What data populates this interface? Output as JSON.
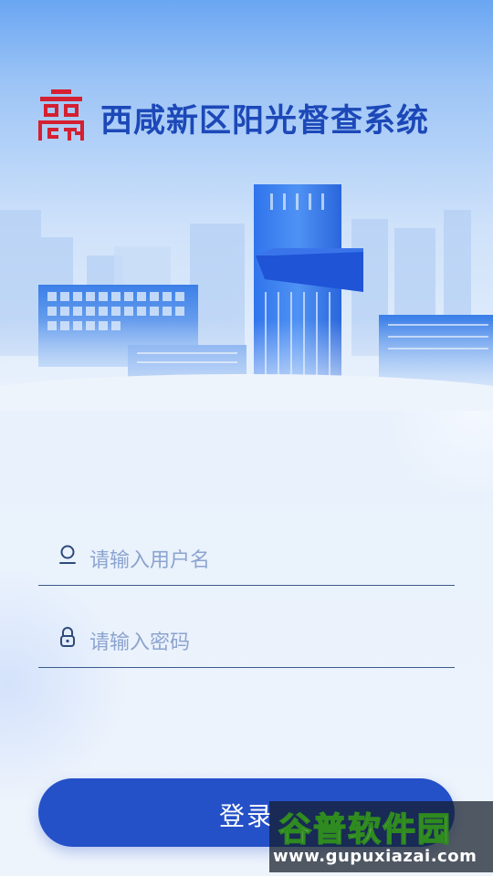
{
  "app": {
    "title": "西咸新区阳光督查系统",
    "logo_icon": "red-seal-logo-icon"
  },
  "login_form": {
    "username_placeholder": "请输入用户名",
    "password_placeholder": "请输入密码",
    "username_icon": "user-icon",
    "password_icon": "lock-icon",
    "submit_label": "登录"
  },
  "watermark": {
    "brand": "谷普软件园",
    "url": "www.gupuxiazai.com"
  },
  "colors": {
    "title": "#1c48b8",
    "logo": "#d42030",
    "button": "#2450c8",
    "input_line": "#3c5a8c",
    "placeholder": "#8ca4cf"
  }
}
